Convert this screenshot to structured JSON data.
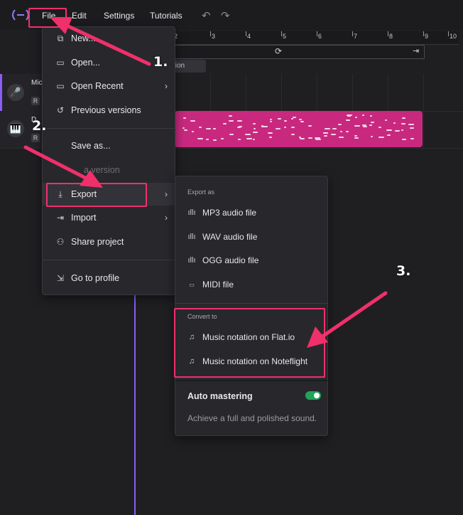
{
  "menubar": {
    "items": [
      "File",
      "Edit",
      "Settings",
      "Tutorials"
    ],
    "undo_icon": "undo-icon",
    "redo_icon": "redo-icon"
  },
  "studio": {
    "ruler_ticks": [
      "2",
      "3",
      "4",
      "5",
      "6",
      "7",
      "8",
      "9",
      "10"
    ],
    "section_label": "tion",
    "tracks": [
      {
        "name": "Mic",
        "solo_label": "R",
        "icon": "microphone-icon"
      },
      {
        "name": "D",
        "solo_label": "R",
        "icon": "piano-icon"
      }
    ]
  },
  "file_menu": {
    "items": [
      {
        "label": "New...",
        "icon": "new-file-icon"
      },
      {
        "label": "Open...",
        "icon": "folder-icon"
      },
      {
        "label": "Open Recent",
        "icon": "folder-icon",
        "has_submenu": true
      },
      {
        "label": "Previous versions",
        "icon": "history-icon"
      },
      {
        "label": "Save as...",
        "icon": ""
      },
      {
        "label": "a version",
        "icon": "",
        "disabled": true
      },
      {
        "label": "Export",
        "icon": "download-icon",
        "has_submenu": true,
        "highlighted": true
      },
      {
        "label": "Import",
        "icon": "import-icon",
        "has_submenu": true
      },
      {
        "label": "Share project",
        "icon": "users-icon"
      },
      {
        "label": "Go to profile",
        "icon": "logout-icon"
      }
    ]
  },
  "export_menu": {
    "export_heading": "Export as",
    "export_items": [
      {
        "label": "MP3 audio file",
        "icon": "waveform-icon"
      },
      {
        "label": "WAV audio file",
        "icon": "waveform-icon"
      },
      {
        "label": "OGG audio file",
        "icon": "waveform-icon"
      },
      {
        "label": "MIDI file",
        "icon": "midi-icon"
      }
    ],
    "convert_heading": "Convert to",
    "convert_items": [
      {
        "label": "Music notation on Flat.io",
        "icon": "music-note-icon"
      },
      {
        "label": "Music notation on Noteflight",
        "icon": "music-note-icon"
      }
    ],
    "auto_mastering": {
      "title": "Auto mastering",
      "description": "Achieve a full and polished sound.",
      "enabled": true
    }
  },
  "annotations": {
    "steps": [
      "1.",
      "2.",
      "3."
    ],
    "color": "#f0306b"
  }
}
